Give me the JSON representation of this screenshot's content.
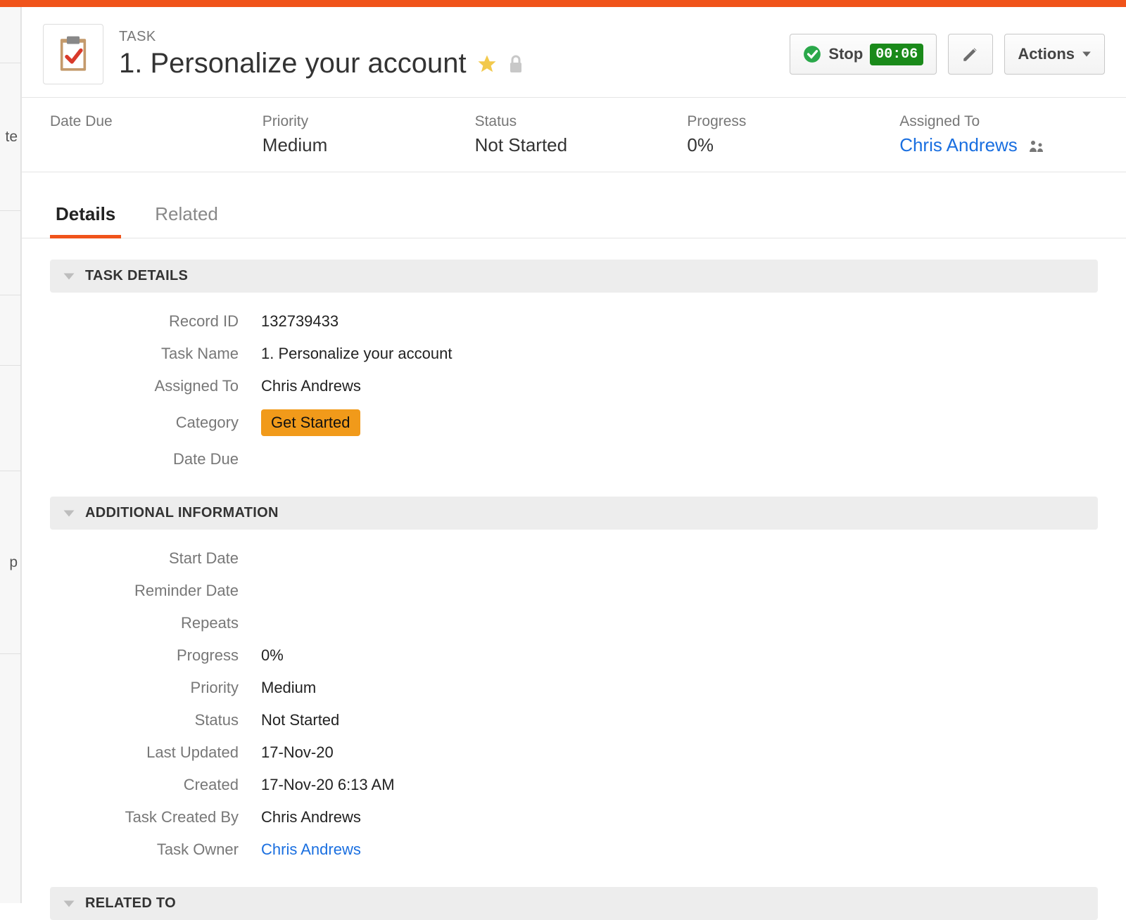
{
  "header": {
    "type_label": "TASK",
    "title": "1. Personalize your account",
    "stop_label": "Stop",
    "timer": "00:06",
    "actions_label": "Actions"
  },
  "summary": {
    "date_due_label": "Date Due",
    "date_due_value": "",
    "priority_label": "Priority",
    "priority_value": "Medium",
    "status_label": "Status",
    "status_value": "Not Started",
    "progress_label": "Progress",
    "progress_value": "0%",
    "assigned_label": "Assigned To",
    "assigned_value": "Chris Andrews"
  },
  "tabs": {
    "details": "Details",
    "related": "Related"
  },
  "sections": {
    "task_details": "TASK DETAILS",
    "additional_info": "ADDITIONAL INFORMATION",
    "related_to": "RELATED TO"
  },
  "task_details_fields": [
    {
      "label": "Record ID",
      "value": "132739433"
    },
    {
      "label": "Task Name",
      "value": "1. Personalize your account"
    },
    {
      "label": "Assigned To",
      "value": "Chris Andrews"
    },
    {
      "label": "Category",
      "value": "Get Started",
      "chip": true
    },
    {
      "label": "Date Due",
      "value": ""
    }
  ],
  "additional_fields": [
    {
      "label": "Start Date",
      "value": ""
    },
    {
      "label": "Reminder Date",
      "value": ""
    },
    {
      "label": "Repeats",
      "value": ""
    },
    {
      "label": "Progress",
      "value": "0%"
    },
    {
      "label": "Priority",
      "value": "Medium"
    },
    {
      "label": "Status",
      "value": "Not Started"
    },
    {
      "label": "Last Updated",
      "value": "17-Nov-20"
    },
    {
      "label": "Created",
      "value": "17-Nov-20 6:13 AM"
    },
    {
      "label": "Task Created By",
      "value": "Chris Andrews"
    },
    {
      "label": "Task Owner",
      "value": "Chris Andrews",
      "link": true
    }
  ]
}
